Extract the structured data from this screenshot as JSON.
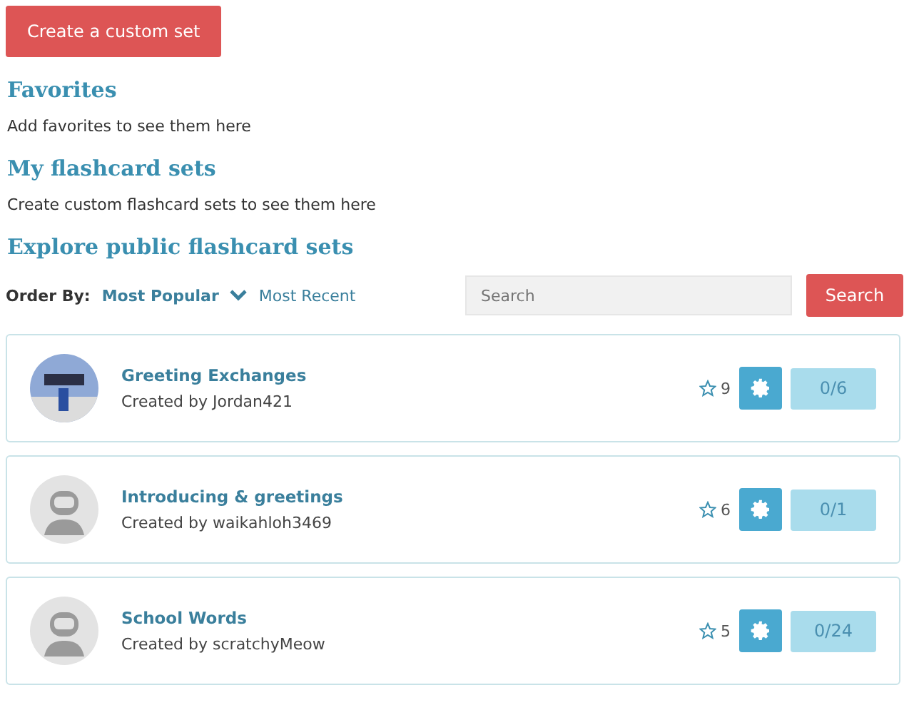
{
  "create_button": "Create a custom set",
  "sections": [
    {
      "title": "Favorites",
      "text": "Add favorites to see them here"
    },
    {
      "title": "My flashcard sets",
      "text": "Create custom flashcard sets to see them here"
    }
  ],
  "explore": {
    "title": "Explore public flashcard sets",
    "order_label": "Order By:",
    "order_options": [
      {
        "label": "Most Popular",
        "selected": true
      },
      {
        "label": "Most Recent",
        "selected": false
      }
    ],
    "search": {
      "placeholder": "Search",
      "button": "Search"
    }
  },
  "sets": [
    {
      "kind": "photo",
      "title": "Greeting Exchanges",
      "creator": "Created by Jordan421",
      "stars": "9",
      "progress": "0/6"
    },
    {
      "kind": "default",
      "title": "Introducing & greetings",
      "creator": "Created by waikahloh3469",
      "stars": "6",
      "progress": "0/1"
    },
    {
      "kind": "default",
      "title": "School Words",
      "creator": "Created by scratchyMeow",
      "stars": "5",
      "progress": "0/24"
    }
  ]
}
